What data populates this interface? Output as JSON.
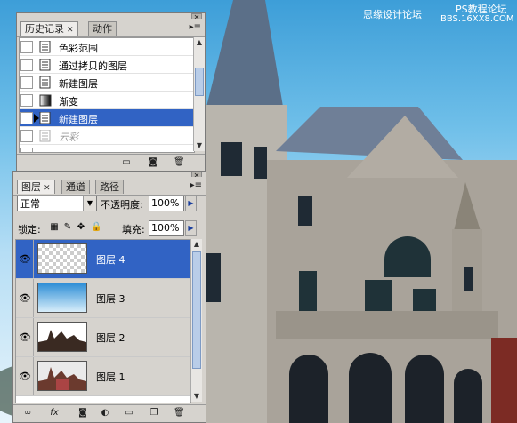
{
  "watermark": {
    "site_cn": "思缘设计论坛",
    "site_ps": "PS教程论坛",
    "site_url": "BBS.16XX8.COM"
  },
  "history_panel": {
    "tabs": [
      {
        "label": "历史记录",
        "active": true
      },
      {
        "label": "动作",
        "active": false
      }
    ],
    "items": [
      {
        "label": "色彩范围",
        "icon": "document-icon",
        "state": "normal"
      },
      {
        "label": "通过拷贝的图层",
        "icon": "document-icon",
        "state": "normal"
      },
      {
        "label": "新建图层",
        "icon": "document-icon",
        "state": "normal"
      },
      {
        "label": "渐变",
        "icon": "gradient-icon",
        "state": "normal"
      },
      {
        "label": "新建图层",
        "icon": "document-icon",
        "state": "selected"
      },
      {
        "label": "云彩",
        "icon": "document-icon",
        "state": "ghost"
      }
    ]
  },
  "layers_panel": {
    "tabs": [
      {
        "label": "图层",
        "active": true
      },
      {
        "label": "通道",
        "active": false
      },
      {
        "label": "路径",
        "active": false
      }
    ],
    "blend_mode": "正常",
    "opacity_label": "不透明度:",
    "opacity_value": "100%",
    "lock_label": "锁定:",
    "fill_label": "填充:",
    "fill_value": "100%",
    "layers": [
      {
        "name": "图层 4",
        "thumb": "transparent",
        "selected": true
      },
      {
        "name": "图层 3",
        "thumb": "sky-gradient",
        "selected": false
      },
      {
        "name": "图层 2",
        "thumb": "castle-silhouette",
        "selected": false
      },
      {
        "name": "图层 1",
        "thumb": "castle-photo",
        "selected": false
      }
    ]
  },
  "colors": {
    "selection": "#3163c4",
    "panel_bg": "#d6d3ce"
  }
}
